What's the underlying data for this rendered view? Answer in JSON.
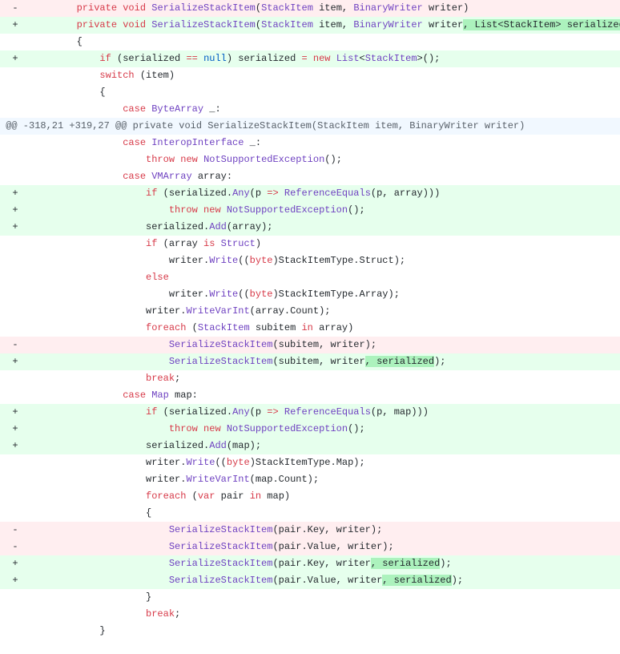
{
  "lines": [
    {
      "type": "del",
      "sign": "-",
      "indent": "        ",
      "segments": [
        {
          "text": "private",
          "cls": "kw"
        },
        {
          "text": " "
        },
        {
          "text": "void",
          "cls": "kw"
        },
        {
          "text": " "
        },
        {
          "text": "SerializeStackItem",
          "cls": "fn"
        },
        {
          "text": "("
        },
        {
          "text": "StackItem",
          "cls": "type"
        },
        {
          "text": " "
        },
        {
          "text": "item",
          "cls": ""
        },
        {
          "text": ", "
        },
        {
          "text": "BinaryWriter",
          "cls": "type"
        },
        {
          "text": " "
        },
        {
          "text": "writer",
          "cls": ""
        },
        {
          "text": ")"
        }
      ]
    },
    {
      "type": "add",
      "sign": "+",
      "indent": "        ",
      "segments": [
        {
          "text": "private",
          "cls": "kw"
        },
        {
          "text": " "
        },
        {
          "text": "void",
          "cls": "kw"
        },
        {
          "text": " "
        },
        {
          "text": "SerializeStackItem",
          "cls": "fn"
        },
        {
          "text": "("
        },
        {
          "text": "StackItem",
          "cls": "type"
        },
        {
          "text": " "
        },
        {
          "text": "item",
          "cls": ""
        },
        {
          "text": ", "
        },
        {
          "text": "BinaryWriter",
          "cls": "type"
        },
        {
          "text": " "
        },
        {
          "text": "writer",
          "cls": ""
        },
        {
          "text": ", List<StackItem> serialized = null",
          "cls": "x-add"
        },
        {
          "text": ")"
        }
      ]
    },
    {
      "type": "ctx",
      "sign": " ",
      "indent": "        ",
      "segments": [
        {
          "text": "{"
        }
      ]
    },
    {
      "type": "add",
      "sign": "+",
      "indent": "            ",
      "segments": [
        {
          "text": "if",
          "cls": "kw"
        },
        {
          "text": " (serialized "
        },
        {
          "text": "==",
          "cls": "kw"
        },
        {
          "text": " "
        },
        {
          "text": "null",
          "cls": "const"
        },
        {
          "text": ") serialized "
        },
        {
          "text": "=",
          "cls": "kw"
        },
        {
          "text": " "
        },
        {
          "text": "new",
          "cls": "kw"
        },
        {
          "text": " "
        },
        {
          "text": "List",
          "cls": "type"
        },
        {
          "text": "<"
        },
        {
          "text": "StackItem",
          "cls": "type"
        },
        {
          "text": ">();"
        }
      ]
    },
    {
      "type": "ctx",
      "sign": " ",
      "indent": "            ",
      "segments": [
        {
          "text": "switch",
          "cls": "kw"
        },
        {
          "text": " (item)"
        }
      ]
    },
    {
      "type": "ctx",
      "sign": " ",
      "indent": "            ",
      "segments": [
        {
          "text": "{"
        }
      ]
    },
    {
      "type": "ctx",
      "sign": " ",
      "indent": "                ",
      "segments": [
        {
          "text": "case",
          "cls": "kw"
        },
        {
          "text": " "
        },
        {
          "text": "ByteArray",
          "cls": "type"
        },
        {
          "text": " "
        },
        {
          "text": "_",
          "cls": ""
        },
        {
          "text": ":"
        }
      ]
    },
    {
      "type": "hunk",
      "sign": "",
      "indent": "",
      "segments": [
        {
          "text": "@@ -318,21 +319,27 @@ private void SerializeStackItem(StackItem item, BinaryWriter writer)"
        }
      ]
    },
    {
      "type": "ctx",
      "sign": " ",
      "indent": "                ",
      "segments": [
        {
          "text": "case",
          "cls": "kw"
        },
        {
          "text": " "
        },
        {
          "text": "InteropInterface",
          "cls": "type"
        },
        {
          "text": " "
        },
        {
          "text": "_",
          "cls": ""
        },
        {
          "text": ":"
        }
      ]
    },
    {
      "type": "ctx",
      "sign": " ",
      "indent": "                    ",
      "segments": [
        {
          "text": "throw",
          "cls": "kw"
        },
        {
          "text": " "
        },
        {
          "text": "new",
          "cls": "kw"
        },
        {
          "text": " "
        },
        {
          "text": "NotSupportedException",
          "cls": "type"
        },
        {
          "text": "();"
        }
      ]
    },
    {
      "type": "ctx",
      "sign": " ",
      "indent": "                ",
      "segments": [
        {
          "text": "case",
          "cls": "kw"
        },
        {
          "text": " "
        },
        {
          "text": "VMArray",
          "cls": "type"
        },
        {
          "text": " "
        },
        {
          "text": "array",
          "cls": ""
        },
        {
          "text": ":"
        }
      ]
    },
    {
      "type": "add",
      "sign": "+",
      "indent": "                    ",
      "segments": [
        {
          "text": "if",
          "cls": "kw"
        },
        {
          "text": " (serialized."
        },
        {
          "text": "Any",
          "cls": "fn"
        },
        {
          "text": "("
        },
        {
          "text": "p",
          "cls": ""
        },
        {
          "text": " "
        },
        {
          "text": "=>",
          "cls": "kw"
        },
        {
          "text": " "
        },
        {
          "text": "ReferenceEquals",
          "cls": "fn"
        },
        {
          "text": "(p, array)))"
        }
      ]
    },
    {
      "type": "add",
      "sign": "+",
      "indent": "                        ",
      "segments": [
        {
          "text": "throw",
          "cls": "kw"
        },
        {
          "text": " "
        },
        {
          "text": "new",
          "cls": "kw"
        },
        {
          "text": " "
        },
        {
          "text": "NotSupportedException",
          "cls": "type"
        },
        {
          "text": "();"
        }
      ]
    },
    {
      "type": "add",
      "sign": "+",
      "indent": "                    ",
      "segments": [
        {
          "text": "serialized."
        },
        {
          "text": "Add",
          "cls": "fn"
        },
        {
          "text": "(array);"
        }
      ]
    },
    {
      "type": "ctx",
      "sign": " ",
      "indent": "                    ",
      "segments": [
        {
          "text": "if",
          "cls": "kw"
        },
        {
          "text": " (array "
        },
        {
          "text": "is",
          "cls": "kw"
        },
        {
          "text": " "
        },
        {
          "text": "Struct",
          "cls": "type"
        },
        {
          "text": ")"
        }
      ]
    },
    {
      "type": "ctx",
      "sign": " ",
      "indent": "                        ",
      "segments": [
        {
          "text": "writer."
        },
        {
          "text": "Write",
          "cls": "fn"
        },
        {
          "text": "(("
        },
        {
          "text": "byte",
          "cls": "kw"
        },
        {
          "text": ")StackItemType.Struct);"
        }
      ]
    },
    {
      "type": "ctx",
      "sign": " ",
      "indent": "                    ",
      "segments": [
        {
          "text": "else",
          "cls": "kw"
        }
      ]
    },
    {
      "type": "ctx",
      "sign": " ",
      "indent": "                        ",
      "segments": [
        {
          "text": "writer."
        },
        {
          "text": "Write",
          "cls": "fn"
        },
        {
          "text": "(("
        },
        {
          "text": "byte",
          "cls": "kw"
        },
        {
          "text": ")StackItemType.Array);"
        }
      ]
    },
    {
      "type": "ctx",
      "sign": " ",
      "indent": "                    ",
      "segments": [
        {
          "text": "writer."
        },
        {
          "text": "WriteVarInt",
          "cls": "fn"
        },
        {
          "text": "(array.Count);"
        }
      ]
    },
    {
      "type": "ctx",
      "sign": " ",
      "indent": "                    ",
      "segments": [
        {
          "text": "foreach",
          "cls": "kw"
        },
        {
          "text": " ("
        },
        {
          "text": "StackItem",
          "cls": "type"
        },
        {
          "text": " subitem "
        },
        {
          "text": "in",
          "cls": "kw"
        },
        {
          "text": " array)"
        }
      ]
    },
    {
      "type": "del",
      "sign": "-",
      "indent": "                        ",
      "segments": [
        {
          "text": "SerializeStackItem",
          "cls": "fn"
        },
        {
          "text": "(subitem, writer);"
        }
      ]
    },
    {
      "type": "add",
      "sign": "+",
      "indent": "                        ",
      "segments": [
        {
          "text": "SerializeStackItem",
          "cls": "fn"
        },
        {
          "text": "(subitem, writer"
        },
        {
          "text": ", serialized",
          "cls": "x-add"
        },
        {
          "text": ");"
        }
      ]
    },
    {
      "type": "ctx",
      "sign": " ",
      "indent": "                    ",
      "segments": [
        {
          "text": "break",
          "cls": "kw"
        },
        {
          "text": ";"
        }
      ]
    },
    {
      "type": "ctx",
      "sign": " ",
      "indent": "                ",
      "segments": [
        {
          "text": "case",
          "cls": "kw"
        },
        {
          "text": " "
        },
        {
          "text": "Map",
          "cls": "type"
        },
        {
          "text": " "
        },
        {
          "text": "map",
          "cls": ""
        },
        {
          "text": ":"
        }
      ]
    },
    {
      "type": "add",
      "sign": "+",
      "indent": "                    ",
      "segments": [
        {
          "text": "if",
          "cls": "kw"
        },
        {
          "text": " (serialized."
        },
        {
          "text": "Any",
          "cls": "fn"
        },
        {
          "text": "("
        },
        {
          "text": "p",
          "cls": ""
        },
        {
          "text": " "
        },
        {
          "text": "=>",
          "cls": "kw"
        },
        {
          "text": " "
        },
        {
          "text": "ReferenceEquals",
          "cls": "fn"
        },
        {
          "text": "(p, map)))"
        }
      ]
    },
    {
      "type": "add",
      "sign": "+",
      "indent": "                        ",
      "segments": [
        {
          "text": "throw",
          "cls": "kw"
        },
        {
          "text": " "
        },
        {
          "text": "new",
          "cls": "kw"
        },
        {
          "text": " "
        },
        {
          "text": "NotSupportedException",
          "cls": "type"
        },
        {
          "text": "();"
        }
      ]
    },
    {
      "type": "add",
      "sign": "+",
      "indent": "                    ",
      "segments": [
        {
          "text": "serialized."
        },
        {
          "text": "Add",
          "cls": "fn"
        },
        {
          "text": "(map);"
        }
      ]
    },
    {
      "type": "ctx",
      "sign": " ",
      "indent": "                    ",
      "segments": [
        {
          "text": "writer."
        },
        {
          "text": "Write",
          "cls": "fn"
        },
        {
          "text": "(("
        },
        {
          "text": "byte",
          "cls": "kw"
        },
        {
          "text": ")StackItemType.Map);"
        }
      ]
    },
    {
      "type": "ctx",
      "sign": " ",
      "indent": "                    ",
      "segments": [
        {
          "text": "writer."
        },
        {
          "text": "WriteVarInt",
          "cls": "fn"
        },
        {
          "text": "(map.Count);"
        }
      ]
    },
    {
      "type": "ctx",
      "sign": " ",
      "indent": "                    ",
      "segments": [
        {
          "text": "foreach",
          "cls": "kw"
        },
        {
          "text": " ("
        },
        {
          "text": "var",
          "cls": "kw"
        },
        {
          "text": " pair "
        },
        {
          "text": "in",
          "cls": "kw"
        },
        {
          "text": " map)"
        }
      ]
    },
    {
      "type": "ctx",
      "sign": " ",
      "indent": "                    ",
      "segments": [
        {
          "text": "{"
        }
      ]
    },
    {
      "type": "del",
      "sign": "-",
      "indent": "                        ",
      "segments": [
        {
          "text": "SerializeStackItem",
          "cls": "fn"
        },
        {
          "text": "(pair.Key, writer);"
        }
      ]
    },
    {
      "type": "del",
      "sign": "-",
      "indent": "                        ",
      "segments": [
        {
          "text": "SerializeStackItem",
          "cls": "fn"
        },
        {
          "text": "(pair.Value, writer);"
        }
      ]
    },
    {
      "type": "add",
      "sign": "+",
      "indent": "                        ",
      "segments": [
        {
          "text": "SerializeStackItem",
          "cls": "fn"
        },
        {
          "text": "(pair.Key, writer"
        },
        {
          "text": ", serialized",
          "cls": "x-add"
        },
        {
          "text": ");"
        }
      ]
    },
    {
      "type": "add",
      "sign": "+",
      "indent": "                        ",
      "segments": [
        {
          "text": "SerializeStackItem",
          "cls": "fn"
        },
        {
          "text": "(pair.Value, writer"
        },
        {
          "text": ", serialized",
          "cls": "x-add"
        },
        {
          "text": ");"
        }
      ]
    },
    {
      "type": "ctx",
      "sign": " ",
      "indent": "                    ",
      "segments": [
        {
          "text": "}"
        }
      ]
    },
    {
      "type": "ctx",
      "sign": " ",
      "indent": "                    ",
      "segments": [
        {
          "text": "break",
          "cls": "kw"
        },
        {
          "text": ";"
        }
      ]
    },
    {
      "type": "ctx",
      "sign": " ",
      "indent": "            ",
      "segments": [
        {
          "text": "}"
        }
      ]
    }
  ]
}
